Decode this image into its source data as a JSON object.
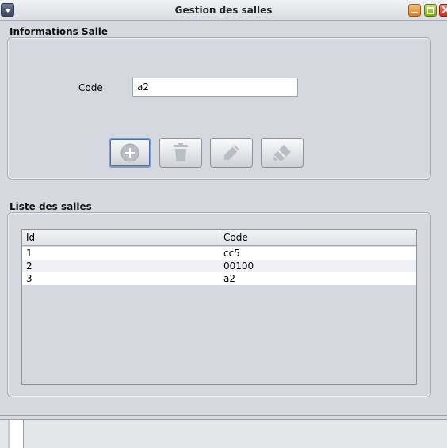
{
  "window": {
    "title": "Gestion des salles"
  },
  "info_section": {
    "title": "Informations Salle",
    "code_label": "Code",
    "code_value": "a2"
  },
  "toolbar": {
    "buttons": [
      {
        "icon": "add-circle-icon"
      },
      {
        "icon": "trash-icon"
      },
      {
        "icon": "pencil-icon"
      },
      {
        "icon": "eraser-icon"
      }
    ]
  },
  "list_section": {
    "title": "Liste des salles",
    "columns": [
      "Id",
      "Code"
    ],
    "rows": [
      [
        "1",
        "cc5"
      ],
      [
        "2",
        "00100"
      ],
      [
        "3",
        "a2"
      ]
    ]
  }
}
